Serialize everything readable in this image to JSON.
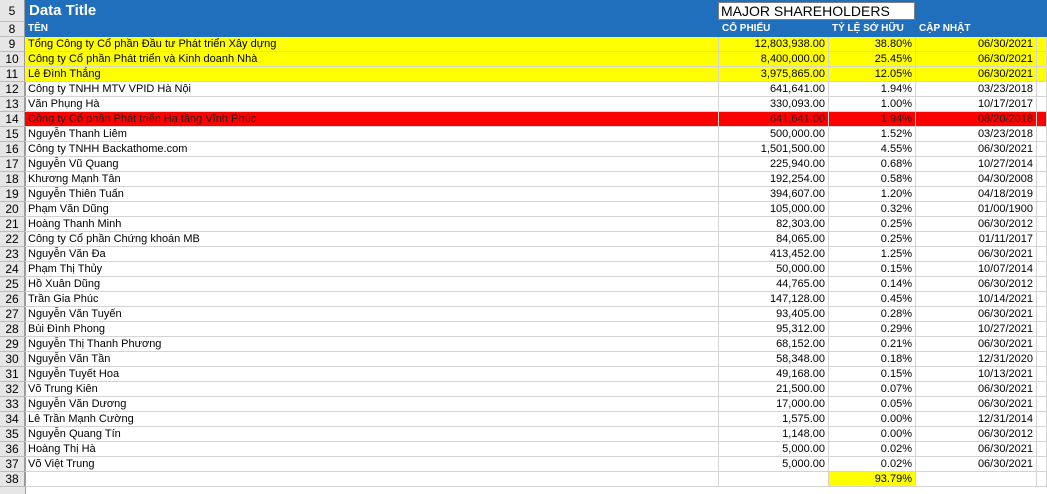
{
  "title_row": {
    "row_number": "5",
    "title": "Data Title",
    "subtitle_box": "MAJOR SHAREHOLDERS"
  },
  "header": {
    "row_number": "8",
    "name": "TÊN",
    "shares": "CỔ PHIẾU",
    "ownership": "TỶ LỆ SỞ HỮU",
    "updated": "CẬP NHẬT"
  },
  "rows": [
    {
      "n": "9",
      "name": "Tổng Công ty Cổ phần Đầu tư Phát triển Xây dựng",
      "shares": "12,803,938.00",
      "pct": "38.80%",
      "date": "06/30/2021",
      "hl": "yellow"
    },
    {
      "n": "10",
      "name": "Công ty Cổ phần Phát triển và Kinh doanh Nhà",
      "shares": "8,400,000.00",
      "pct": "25.45%",
      "date": "06/30/2021",
      "hl": "yellow"
    },
    {
      "n": "11",
      "name": "Lê Đình Thắng",
      "shares": "3,975,865.00",
      "pct": "12.05%",
      "date": "06/30/2021",
      "hl": "yellow"
    },
    {
      "n": "12",
      "name": "Công ty TNHH MTV VPID Hà Nội",
      "shares": "641,641.00",
      "pct": "1.94%",
      "date": "03/23/2018",
      "hl": ""
    },
    {
      "n": "13",
      "name": "Văn Phụng Hà",
      "shares": "330,093.00",
      "pct": "1.00%",
      "date": "10/17/2017",
      "hl": ""
    },
    {
      "n": "14",
      "name": "Công ty Cổ phần Phát triển Hạ tầng Vĩnh Phúc",
      "shares": "641,641.00",
      "pct": "1.94%",
      "date": "08/20/2018",
      "hl": "red"
    },
    {
      "n": "15",
      "name": "Nguyễn Thanh Liêm",
      "shares": "500,000.00",
      "pct": "1.52%",
      "date": "03/23/2018",
      "hl": ""
    },
    {
      "n": "16",
      "name": "Công ty TNHH Backathome.com",
      "shares": "1,501,500.00",
      "pct": "4.55%",
      "date": "06/30/2021",
      "hl": ""
    },
    {
      "n": "17",
      "name": "Nguyễn Vũ Quang",
      "shares": "225,940.00",
      "pct": "0.68%",
      "date": "10/27/2014",
      "hl": ""
    },
    {
      "n": "18",
      "name": "Khương Mạnh Tân",
      "shares": "192,254.00",
      "pct": "0.58%",
      "date": "04/30/2008",
      "hl": ""
    },
    {
      "n": "19",
      "name": "Nguyễn Thiên Tuấn",
      "shares": "394,607.00",
      "pct": "1.20%",
      "date": "04/18/2019",
      "hl": ""
    },
    {
      "n": "20",
      "name": "Phạm Văn Dũng",
      "shares": "105,000.00",
      "pct": "0.32%",
      "date": "01/00/1900",
      "hl": ""
    },
    {
      "n": "21",
      "name": "Hoàng Thanh Minh",
      "shares": "82,303.00",
      "pct": "0.25%",
      "date": "06/30/2012",
      "hl": ""
    },
    {
      "n": "22",
      "name": "Công ty Cổ phần Chứng khoán MB",
      "shares": "84,065.00",
      "pct": "0.25%",
      "date": "01/11/2017",
      "hl": ""
    },
    {
      "n": "23",
      "name": "Nguyễn Văn Đa",
      "shares": "413,452.00",
      "pct": "1.25%",
      "date": "06/30/2021",
      "hl": ""
    },
    {
      "n": "24",
      "name": "Phạm Thị Thủy",
      "shares": "50,000.00",
      "pct": "0.15%",
      "date": "10/07/2014",
      "hl": ""
    },
    {
      "n": "25",
      "name": "Hồ Xuân Dũng",
      "shares": "44,765.00",
      "pct": "0.14%",
      "date": "06/30/2012",
      "hl": ""
    },
    {
      "n": "26",
      "name": "Trần Gia Phúc",
      "shares": "147,128.00",
      "pct": "0.45%",
      "date": "10/14/2021",
      "hl": ""
    },
    {
      "n": "27",
      "name": "Nguyễn Văn Tuyến",
      "shares": "93,405.00",
      "pct": "0.28%",
      "date": "06/30/2021",
      "hl": ""
    },
    {
      "n": "28",
      "name": "Bùi Đình Phong",
      "shares": "95,312.00",
      "pct": "0.29%",
      "date": "10/27/2021",
      "hl": ""
    },
    {
      "n": "29",
      "name": "Nguyễn Thị Thanh Phương",
      "shares": "68,152.00",
      "pct": "0.21%",
      "date": "06/30/2021",
      "hl": ""
    },
    {
      "n": "30",
      "name": "Nguyễn Văn Tần",
      "shares": "58,348.00",
      "pct": "0.18%",
      "date": "12/31/2020",
      "hl": ""
    },
    {
      "n": "31",
      "name": "Nguyễn Tuyết Hoa",
      "shares": "49,168.00",
      "pct": "0.15%",
      "date": "10/13/2021",
      "hl": ""
    },
    {
      "n": "32",
      "name": "Võ Trung Kiên",
      "shares": "21,500.00",
      "pct": "0.07%",
      "date": "06/30/2021",
      "hl": ""
    },
    {
      "n": "33",
      "name": "Nguyễn Văn Dương",
      "shares": "17,000.00",
      "pct": "0.05%",
      "date": "06/30/2021",
      "hl": ""
    },
    {
      "n": "34",
      "name": "Lê Trần Mạnh Cường",
      "shares": "1,575.00",
      "pct": "0.00%",
      "date": "12/31/2014",
      "hl": ""
    },
    {
      "n": "35",
      "name": "Nguyễn Quang Tín",
      "shares": "1,148.00",
      "pct": "0.00%",
      "date": "06/30/2012",
      "hl": ""
    },
    {
      "n": "36",
      "name": "Hoàng Thị Hà",
      "shares": "5,000.00",
      "pct": "0.02%",
      "date": "06/30/2021",
      "hl": ""
    },
    {
      "n": "37",
      "name": "Võ Việt Trung",
      "shares": "5,000.00",
      "pct": "0.02%",
      "date": "06/30/2021",
      "hl": ""
    }
  ],
  "total_row": {
    "n": "38",
    "total_pct": "93.79%"
  },
  "colors": {
    "header_blue": "#1f6fbd",
    "highlight_yellow": "#ffff00",
    "highlight_red": "#ff0000"
  }
}
